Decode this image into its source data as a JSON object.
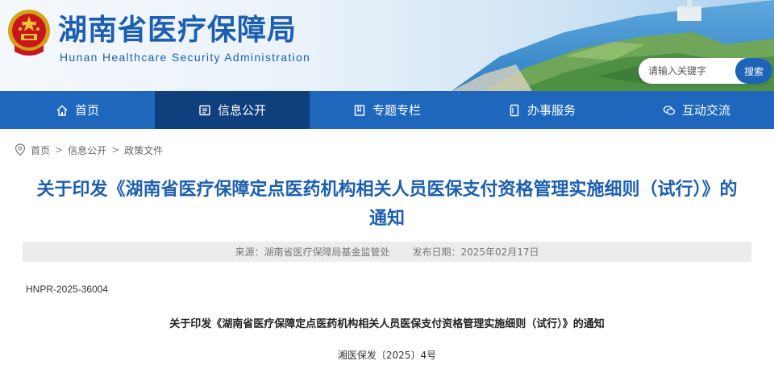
{
  "header": {
    "title": "湖南省医疗保障局",
    "subtitle": "Hunan Healthcare Security Administration",
    "search": {
      "placeholder": "请输入关键字",
      "button_label": "搜索"
    }
  },
  "nav": {
    "items": [
      {
        "label": "首页",
        "icon": "home-icon"
      },
      {
        "label": "信息公开",
        "icon": "document-list-icon",
        "active": true
      },
      {
        "label": "专题专栏",
        "icon": "book-icon"
      },
      {
        "label": "办事服务",
        "icon": "file-icon"
      },
      {
        "label": "互动交流",
        "icon": "chat-icon"
      }
    ]
  },
  "breadcrumb": {
    "icon": "location-pin-icon",
    "items": [
      "首页",
      "信息公开",
      "政策文件"
    ],
    "separator": ">"
  },
  "article": {
    "title": "关于印发《湖南省医疗保障定点医药机构相关人员医保支付资格管理实施细则（试行）》的通知",
    "source": "来源：湖南省医疗保障局基金监管处",
    "date": "发布日期：2025年02月17日",
    "doc_id": "HNPR-2025-36004",
    "heading": "关于印发《湖南省医疗保障定点医药机构相关人员医保支付资格管理实施细则（试行）》的通知",
    "doc_number": "湘医保发〔2025〕4号"
  },
  "colors": {
    "brand_blue": "#1c5fb0",
    "nav_blue": "#1f67bd",
    "nav_active": "#0f3f7d"
  }
}
